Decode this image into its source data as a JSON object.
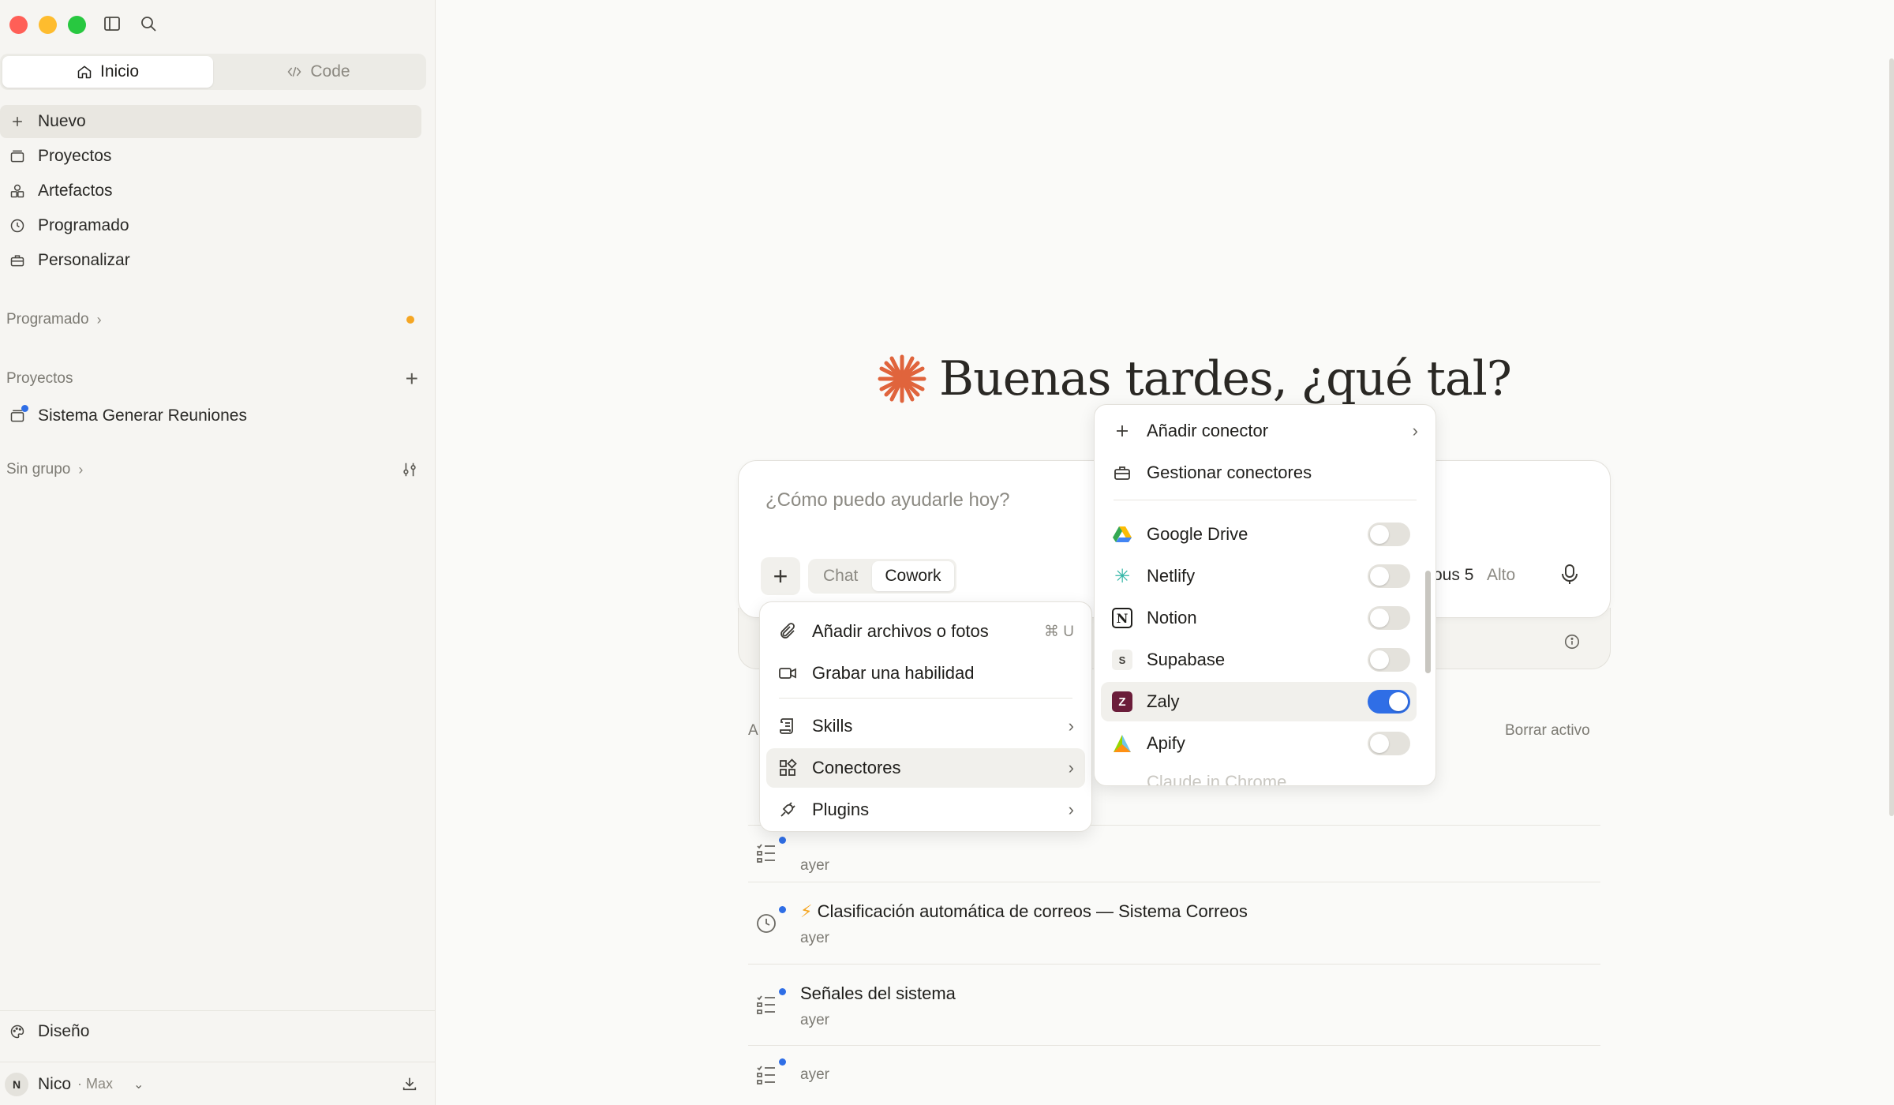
{
  "sidebar": {
    "mode_tabs": [
      {
        "label": "Inicio",
        "icon": "home-icon",
        "active": true
      },
      {
        "label": "Code",
        "icon": "code-icon",
        "active": false
      }
    ],
    "nav": [
      {
        "label": "Nuevo",
        "icon": "plus-icon"
      },
      {
        "label": "Proyectos",
        "icon": "folder-icon"
      },
      {
        "label": "Artefactos",
        "icon": "artifacts-icon"
      },
      {
        "label": "Programado",
        "icon": "clock-icon"
      },
      {
        "label": "Personalizar",
        "icon": "briefcase-icon"
      }
    ],
    "scheduled_header": "Programado",
    "projects_header": "Proyectos",
    "project_item": "Sistema Generar Reuniones",
    "ungrouped_header": "Sin grupo",
    "design_label": "Diseño",
    "user": {
      "initial": "N",
      "name": "Nico",
      "plan": "· Max"
    }
  },
  "main": {
    "greeting": "Buenas tardes, ¿qué tal?",
    "composer": {
      "placeholder": "¿Cómo puedo ayudarle hoy?",
      "mode_chat": "Chat",
      "mode_cowork": "Cowork",
      "model": "ous 5",
      "effort": "Alto"
    },
    "list_header": "A",
    "clear_active": "Borrar activo",
    "tasks": [
      {
        "title": "",
        "time": "ayer",
        "icon": "checklist-icon"
      },
      {
        "title": "Clasificación automática de correos — Sistema Correos",
        "bolt": "⚡",
        "time": "ayer",
        "icon": "clock-icon"
      },
      {
        "title": "Señales del sistema",
        "time": "ayer",
        "icon": "checklist-icon"
      },
      {
        "title": "",
        "time": "ayer",
        "icon": "checklist-icon"
      }
    ]
  },
  "add_menu": {
    "items": [
      {
        "label": "Añadir archivos o fotos",
        "shortcut": "⌘ U",
        "icon": "paperclip-icon"
      },
      {
        "label": "Grabar una habilidad",
        "icon": "video-icon"
      },
      {
        "label": "Skills",
        "icon": "scroll-icon"
      },
      {
        "label": "Conectores",
        "icon": "connectors-icon"
      },
      {
        "label": "Plugins",
        "icon": "plug-icon"
      }
    ]
  },
  "connectors_menu": {
    "add_connector": "Añadir conector",
    "manage_connectors": "Gestionar conectores",
    "connectors": [
      {
        "name": "Google Drive",
        "enabled": false
      },
      {
        "name": "Netlify",
        "enabled": false
      },
      {
        "name": "Notion",
        "enabled": false
      },
      {
        "name": "Supabase",
        "enabled": false
      },
      {
        "name": "Zaly",
        "enabled": true
      },
      {
        "name": "Apify",
        "enabled": false
      }
    ],
    "partial_item": "Claude in Chrome"
  },
  "colors": {
    "accent": "#2f6ee6",
    "spark": "#e0643c",
    "notify": "#f5a623"
  }
}
